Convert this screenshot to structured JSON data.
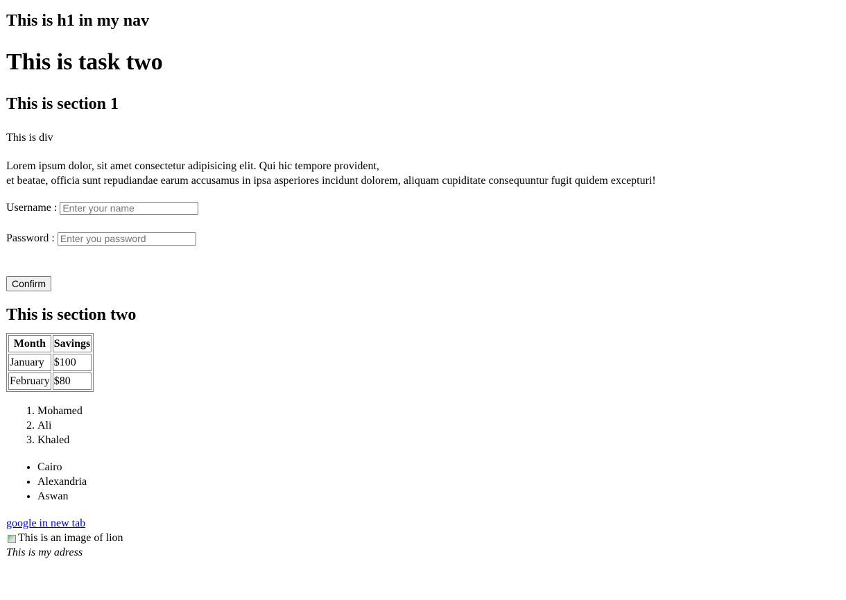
{
  "nav": {
    "heading": "This is h1 in my nav"
  },
  "main": {
    "title": "This is task two"
  },
  "section1": {
    "title": "This is section 1",
    "div_text": "This is div",
    "lorem_line1": "Lorem ipsum dolor, sit amet consectetur adipisicing elit. Qui hic tempore provident,",
    "lorem_line2": "et beatae, officia sunt repudiandae earum accusamus in ipsa asperiores incidunt dolorem, aliquam cupiditate consequuntur fugit quidem excepturi!",
    "username_label": "Username :",
    "username_placeholder": "Enter your name",
    "password_label": "Password :",
    "password_placeholder": "Enter you password",
    "confirm_label": "Confirm"
  },
  "section2": {
    "title": "This is section two",
    "table": {
      "headers": [
        "Month",
        "Savings"
      ],
      "rows": [
        [
          "January",
          "$100"
        ],
        [
          "February",
          "$80"
        ]
      ]
    },
    "ordered_list": [
      "Mohamed",
      "Ali",
      "Khaled"
    ],
    "unordered_list": [
      "Cairo",
      "Alexandria",
      "Aswan"
    ]
  },
  "footer": {
    "link_text": "google in new tab",
    "image_alt": "This is an image of lion",
    "address": "This is my adress"
  },
  "icons": {
    "broken_image": "broken-image-icon"
  },
  "colors": {
    "link": "#0000ee"
  }
}
